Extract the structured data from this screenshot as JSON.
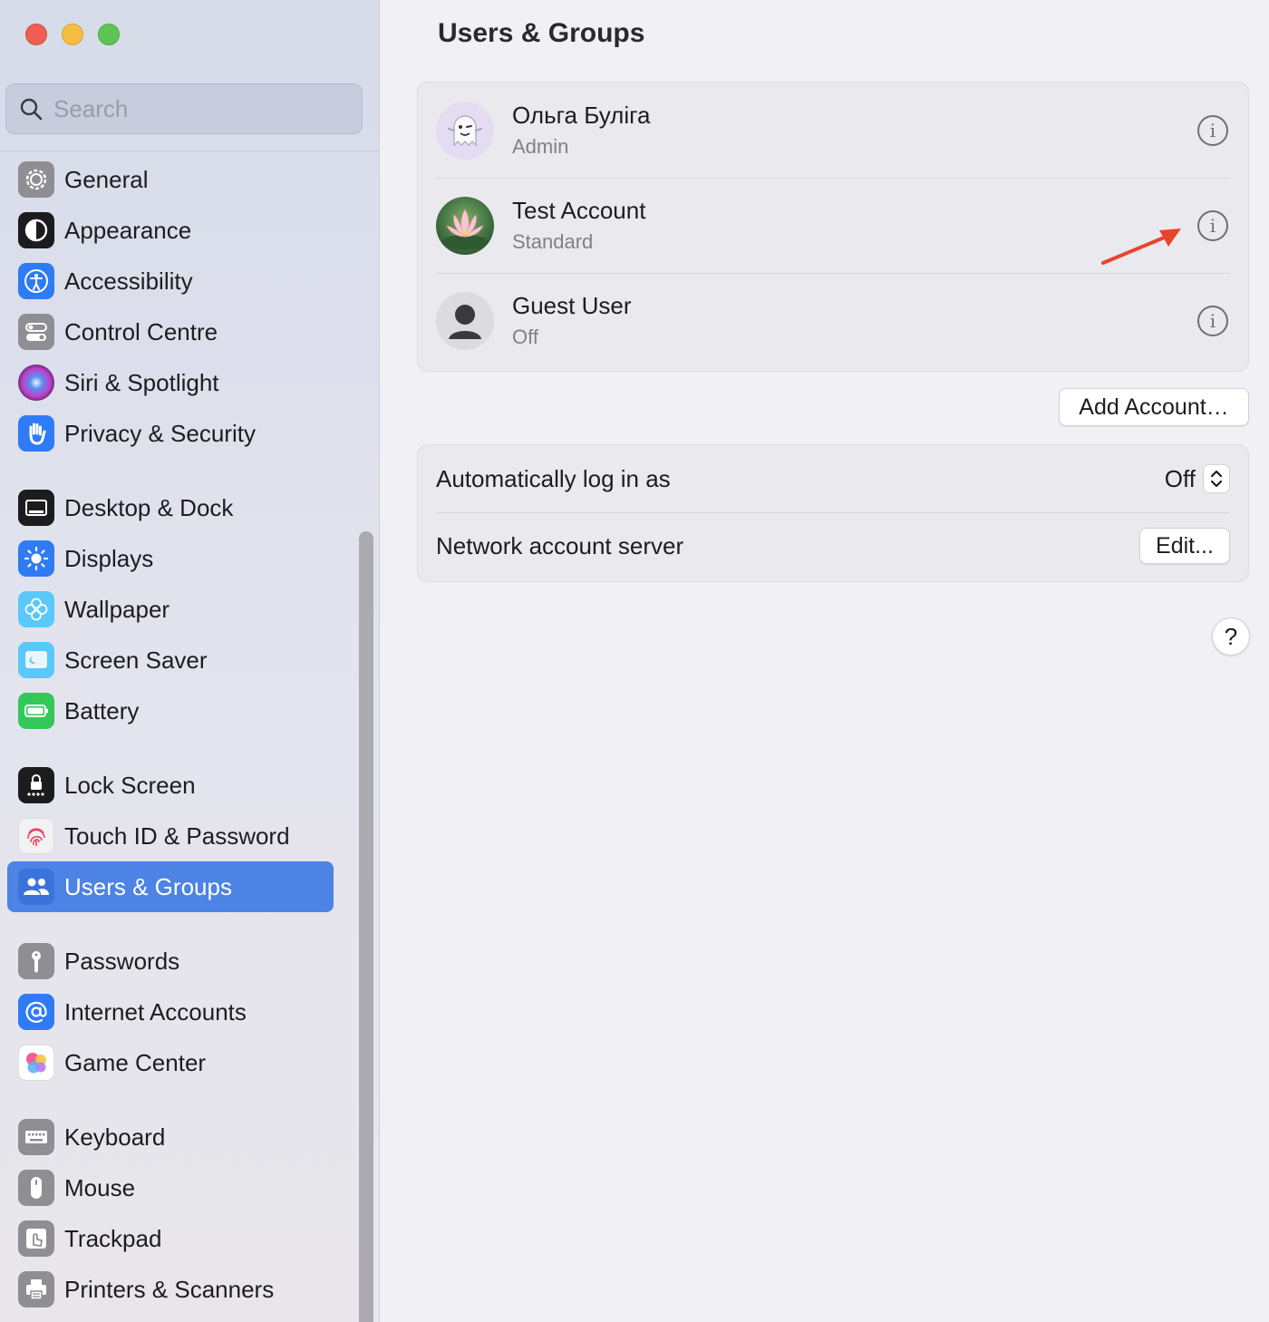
{
  "window": {
    "title": "Users & Groups"
  },
  "search": {
    "placeholder": "Search"
  },
  "sidebar": {
    "items": [
      {
        "label": "General"
      },
      {
        "label": "Appearance"
      },
      {
        "label": "Accessibility"
      },
      {
        "label": "Control Centre"
      },
      {
        "label": "Siri & Spotlight"
      },
      {
        "label": "Privacy & Security"
      },
      {
        "label": "Desktop & Dock"
      },
      {
        "label": "Displays"
      },
      {
        "label": "Wallpaper"
      },
      {
        "label": "Screen Saver"
      },
      {
        "label": "Battery"
      },
      {
        "label": "Lock Screen"
      },
      {
        "label": "Touch ID & Password"
      },
      {
        "label": "Users & Groups"
      },
      {
        "label": "Passwords"
      },
      {
        "label": "Internet Accounts"
      },
      {
        "label": "Game Center"
      },
      {
        "label": "Keyboard"
      },
      {
        "label": "Mouse"
      },
      {
        "label": "Trackpad"
      },
      {
        "label": "Printers & Scanners"
      }
    ],
    "selected": "Users & Groups"
  },
  "users": [
    {
      "name": "Ольга Буліга",
      "role": "Admin"
    },
    {
      "name": "Test Account",
      "role": "Standard"
    },
    {
      "name": "Guest User",
      "role": "Off"
    }
  ],
  "actions": {
    "add_account": "Add Account…",
    "help": "?"
  },
  "settings": {
    "auto_login": {
      "label": "Automatically log in as",
      "value": "Off"
    },
    "network_server": {
      "label": "Network account server",
      "button": "Edit..."
    }
  },
  "colors": {
    "accent": "#4c83e4",
    "annotation_arrow": "#e8432e"
  }
}
